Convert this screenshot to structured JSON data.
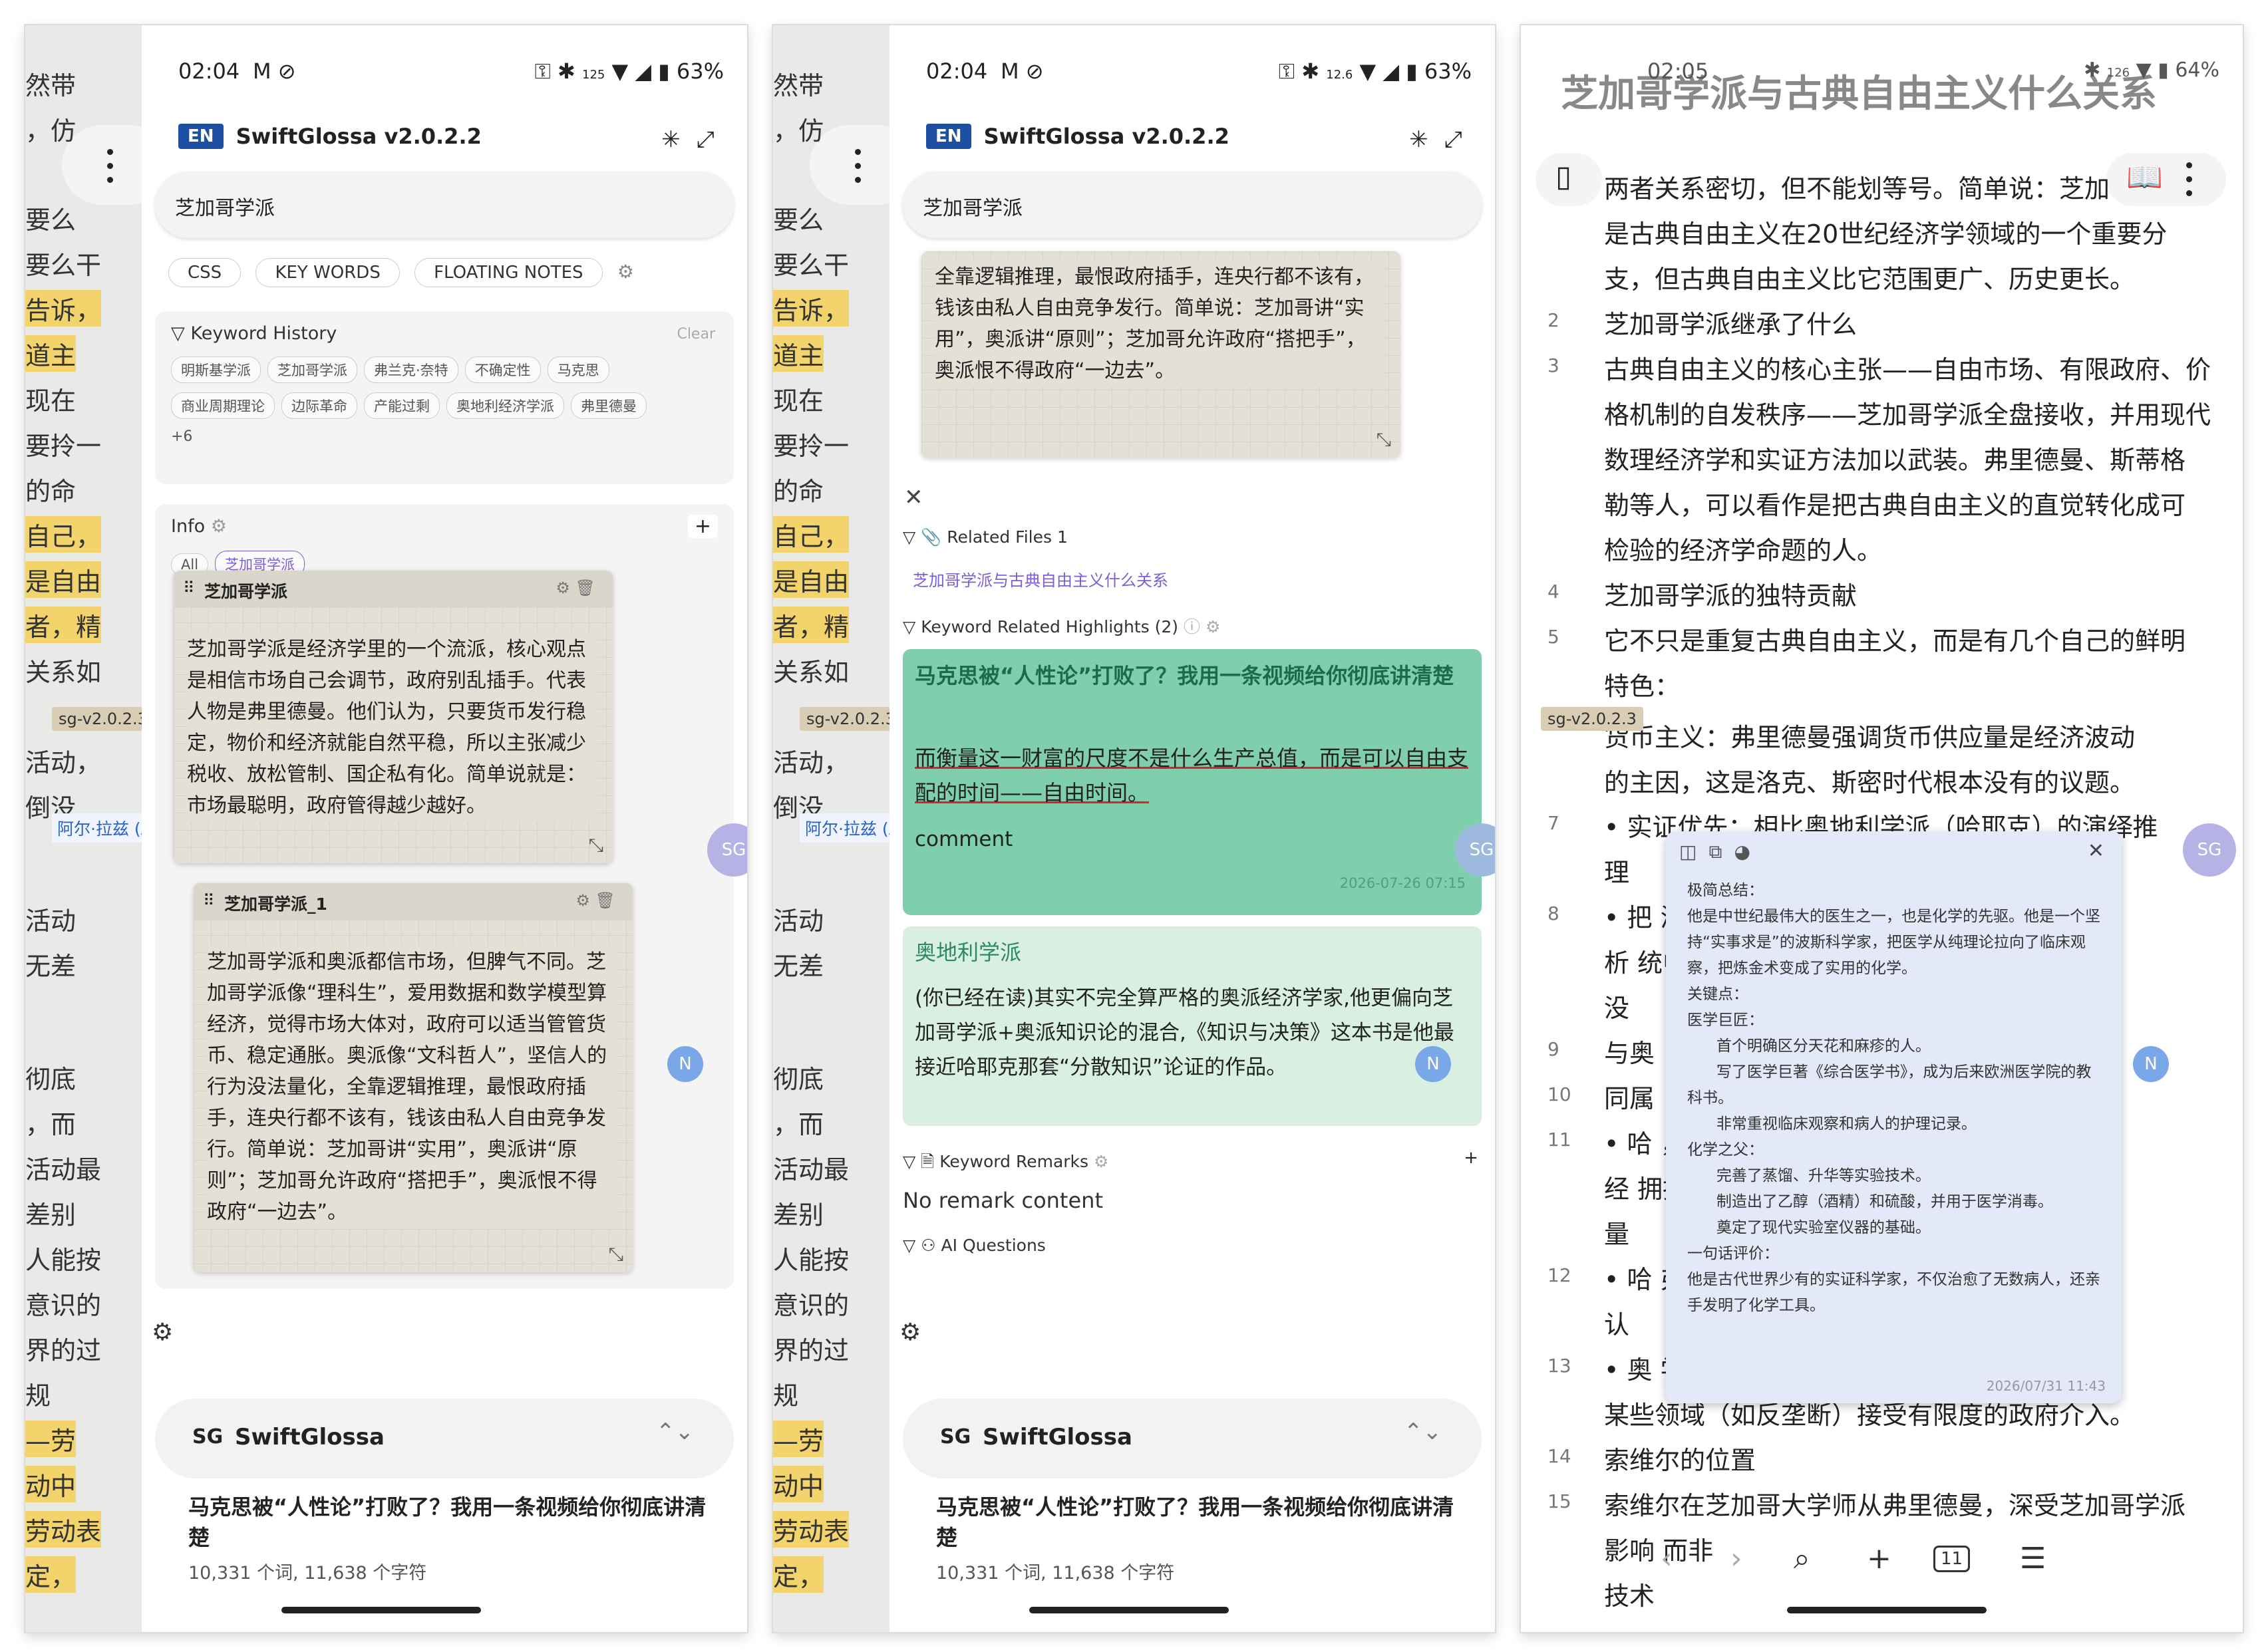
{
  "status_bar": {
    "time_a": "02:04",
    "time_c": "02:05",
    "battery_a": "63%",
    "battery_c": "64%",
    "speed_a": "125",
    "speed_b": "12.6",
    "speed_c": "126",
    "kbs": "KB/s"
  },
  "app": {
    "lang_badge": "EN",
    "title": "SwiftGlossa v2.0.2.2",
    "search_value": "芝加哥学派"
  },
  "tabs": [
    "CSS",
    "KEY WORDS",
    "FLOATING NOTES"
  ],
  "keyword_history": {
    "title": "Keyword History",
    "clear": "Clear",
    "chips": [
      "明斯基学派",
      "芝加哥学派",
      "弗兰克·奈特",
      "不确定性",
      "马克思",
      "商业周期理论",
      "边际革命",
      "产能过剩",
      "奥地利经济学派",
      "弗里德曼",
      "+6"
    ]
  },
  "info": {
    "title": "Info",
    "filter_all": "All",
    "filter_term": "芝加哥学派",
    "add": "+"
  },
  "notes": [
    {
      "title": "芝加哥学派",
      "text": "芝加哥学派是经济学里的一个流派，核心观点是相信市场自己会调节，政府别乱插手。代表人物是弗里德曼。他们认为，只要货币发行稳定，物价和经济就能自然平稳，所以主张减少税收、放松管制、国企私有化。简单说就是：市场最聪明，政府管得越少越好。"
    },
    {
      "title": "芝加哥学派_1",
      "text": "芝加哥学派和奥派都信市场，但脾气不同。芝加哥学派像“理科生”，爱用数据和数学模型算经济，觉得市场大体对，政府可以适当管管货币、稳定通胀。奥派像“文科哲人”，坚信人的行为没法量化，全靠逻辑推理，最恨政府插手，连央行都不该有，钱该由私人自由竞争发行。简单说：芝加哥讲“实用”，奥派讲“原则”；芝加哥允许政府“搭把手”，奥派恨不得政府“一边去”。"
    }
  ],
  "snippet_b": "全靠逻辑推理，最恨政府插手，连央行都不该有，钱该由私人自由竞争发行。简单说：芝加哥讲“实用”，奥派讲“原则”；芝加哥允许政府“搭把手”，奥派恨不得政府“一边去”。",
  "related_files": {
    "title": "Related Files 1",
    "file": "芝加哥学派与古典自由主义什么关系"
  },
  "keyword_highlights": {
    "title": "Keyword Related Highlights (2)",
    "h1_title": "马克思被“人性论”打败了？我用一条视频给你彻底讲清楚",
    "h1_quote": "而衡量这一财富的尺度不是什么生产总值，而是可以自由支配的时间——自由时间。",
    "h1_comment": "comment",
    "h1_date": "2026-07-26 07:15",
    "h2_title": "奥地利学派",
    "h2_text": "(你已经在读)其实不完全算严格的奥派经济学家,他更偏向芝加哥学派+奥派知识论的混合,《知识与决策》这本书是他最接近哈耶克那套“分散知识”论证的作品。"
  },
  "keyword_remarks": {
    "title": "Keyword Remarks",
    "empty": "No remark content"
  },
  "ai_questions": {
    "title": "AI Questions"
  },
  "bottom": {
    "sg": "SG",
    "name": "SwiftGlossa",
    "doc_title": "马克思被“人性论”打败了？我用一条视频给你彻底讲清楚",
    "doc_meta": "10,331 个词, 11,638 个字符"
  },
  "floating": {
    "sg": "SG",
    "n": "N",
    "version": "sg-v2.0.2.3",
    "name_tag": "阿尔·拉兹 (Al-Ra"
  },
  "background_lines": [
    "然带",
    "，仿",
    "要么",
    "要么干",
    "告诉，",
    "道主",
    "现在",
    "要拎一",
    "的命",
    "自己，",
    "是自由",
    "者，精",
    "关系如",
    "活动，",
    "倒没",
    "活动",
    "无差",
    "彻底",
    "，而",
    "活动最",
    "差别",
    "人能按",
    "意识的",
    "界的过",
    "规",
    "—劳",
    "动中",
    "劳动表",
    "定，"
  ],
  "reader": {
    "title": "芝加哥学派与古典自由主义什么关系",
    "lines": [
      {
        "n": "",
        "t": "两者关系密切，但不能划等号。简单说：芝加"
      },
      {
        "n": "",
        "t": "是古典自由主义在20世纪经济学领域的一个重要分"
      },
      {
        "n": "",
        "t": "支，但古典自由主义比它范围更广、历史更长。"
      },
      {
        "n": "2",
        "t": "芝加哥学派继承了什么"
      },
      {
        "n": "3",
        "t": "古典自由主义的核心主张——自由市场、有限政府、价"
      },
      {
        "n": "",
        "t": "格机制的自发秩序——芝加哥学派全盘接收，并用现代"
      },
      {
        "n": "",
        "t": "数理经济学和实证方法加以武装。弗里德曼、斯蒂格"
      },
      {
        "n": "",
        "t": "勒等人，可以看作是把古典自由主义的直觉转化成可"
      },
      {
        "n": "",
        "t": "检验的经济学命题的人。"
      },
      {
        "n": "4",
        "t": "芝加哥学派的独特贡献"
      },
      {
        "n": "5",
        "t": "它不只是重复古典自由主义，而是有几个自己的鲜明"
      },
      {
        "n": "",
        "t": "特色："
      },
      {
        "n": "",
        "t": "   货币主义：弗里德曼强调货币供应量是经济波动"
      },
      {
        "n": "",
        "t": "   的主因，这是洛克、斯密时代根本没有的议题。"
      },
      {
        "n": "7",
        "t": " • 实证优先：相比奥地利学派（哈耶克）的演绎推"
      },
      {
        "n": "",
        "t": "   理"
      },
      {
        "n": "8",
        "t": " • 把                                                    济学分"
      },
      {
        "n": "",
        "t": "   析                                                    统中"
      },
      {
        "n": "",
        "t": "   没"
      },
      {
        "n": "9",
        "t": "与奥"
      },
      {
        "n": "10",
        "t": "同属"
      },
      {
        "n": "11",
        "t": " • 哈                                                    ，认为"
      },
      {
        "n": "",
        "t": "   经                                                    拥抱计"
      },
      {
        "n": "",
        "t": "   量"
      },
      {
        "n": "12",
        "t": " • 哈                                                  弗里德曼"
      },
      {
        "n": "",
        "t": "   认"
      },
      {
        "n": "13",
        "t": " • 奥                                                  学派在"
      },
      {
        "n": "",
        "t": "   某些领域（如反垄断）接受有限度的政府介入。"
      },
      {
        "n": "14",
        "t": "索维尔的位置"
      },
      {
        "n": "15",
        "t": "索维尔在芝加哥大学师从弗里德曼，深受芝加哥学派"
      },
      {
        "n": "",
        "t": "影响                                                        而非"
      },
      {
        "n": "",
        "t": "技术"
      }
    ],
    "page_badge": "11"
  },
  "popup": {
    "text": "极简总结：\n他是中世纪最伟大的医生之一，也是化学的先驱。他是一个坚持“实事求是”的波斯科学家，把医学从纯理论拉向了临床观察，把炼金术变成了实用的化学。\n关键点：\n医学巨匠：\n      首个明确区分天花和麻疹的人。\n      写了医学巨著《综合医学书》，成为后来欧洲医学院的教科书。\n      非常重视临床观察和病人的护理记录。\n化学之父：\n      完善了蒸馏、升华等实验技术。\n      制造出了乙醇（酒精）和硫酸，并用于医学消毒。\n      奠定了现代实验室仪器的基础。\n一句话评价：\n他是古代世界少有的实证科学家，不仅治愈了无数病人，还亲手发明了化学工具。",
    "date": "2026/07/31 11:43"
  }
}
